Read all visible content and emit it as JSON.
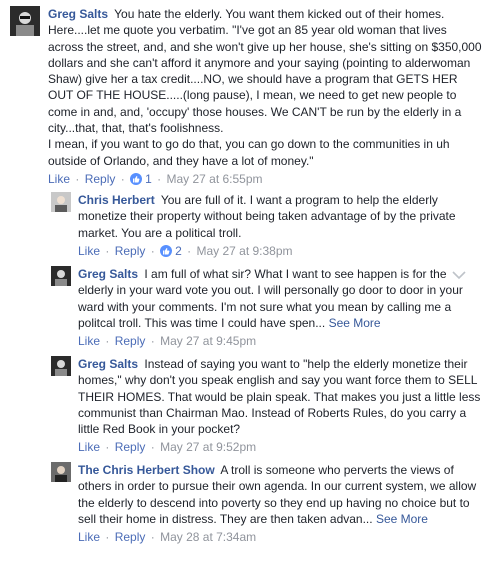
{
  "comments": [
    {
      "author": "Greg Salts",
      "text": "You hate the elderly. You want them kicked out of their homes. Here....let me quote you verbatim. \"I've got an 85 year old woman that lives across the street, and, and she won't give up her house, she's sitting on $350,000 dollars and she can't afford it anymore and your saying (pointing to alderwoman Shaw) give her a tax credit....NO, we should have a program that GETS HER OUT OF THE HOUSE.....(long pause), I mean, we need to get new people to come in and, and, 'occupy' those houses. We CAN'T be run by the elderly in a city...that, that, that's foolishness.\nI mean, if you want to go do that, you can go down to the communities in uh outside of Orlando, and they have a lot of money.\"",
      "like_label": "Like",
      "reply_label": "Reply",
      "reaction_count": "1",
      "timestamp": "May 27 at 6:55pm",
      "see_more": ""
    },
    {
      "author": "Chris Herbert",
      "text": "You are full of it. I want a program to help the elderly monetize their property without being taken advantage of by the private market. You are a political troll.",
      "like_label": "Like",
      "reply_label": "Reply",
      "reaction_count": "2",
      "timestamp": "May 27 at 9:38pm",
      "see_more": ""
    },
    {
      "author": "Greg Salts",
      "text": "I am full of what sir? What I want to see happen is for the elderly in your ward vote you out. I will personally go door to door in your ward with your comments. I'm not sure what you mean by calling me a politcal troll. This was time I could have spen...",
      "like_label": "Like",
      "reply_label": "Reply",
      "reaction_count": "",
      "timestamp": "May 27 at 9:45pm",
      "see_more": "See More"
    },
    {
      "author": "Greg Salts",
      "text": "Instead of saying you want to \"help the elderly monetize their homes,\" why don't you speak english and say you want force them to SELL THEIR HOMES. That would be plain speak. That makes you just a little less communist than Chairman Mao. Instead of Roberts Rules, do you carry a little Red Book in your pocket?",
      "like_label": "Like",
      "reply_label": "Reply",
      "reaction_count": "",
      "timestamp": "May 27 at 9:52pm",
      "see_more": ""
    },
    {
      "author": "The Chris Herbert Show",
      "text": "A troll is someone who perverts the views of others in order to pursue their own agenda. In our current system, we allow the elderly to descend into poverty so they end up having no choice but to sell their home in distress. They are then taken advan...",
      "like_label": "Like",
      "reply_label": "Reply",
      "reaction_count": "",
      "timestamp": "May 28 at 7:34am",
      "see_more": "See More"
    }
  ],
  "colors": {
    "link": "#365899",
    "meta": "#90949c",
    "text": "#1d2129",
    "like_badge": "#5890ff"
  },
  "icons": {
    "reaction": "thumbs-up-icon",
    "menu": "chevron-down-icon"
  }
}
